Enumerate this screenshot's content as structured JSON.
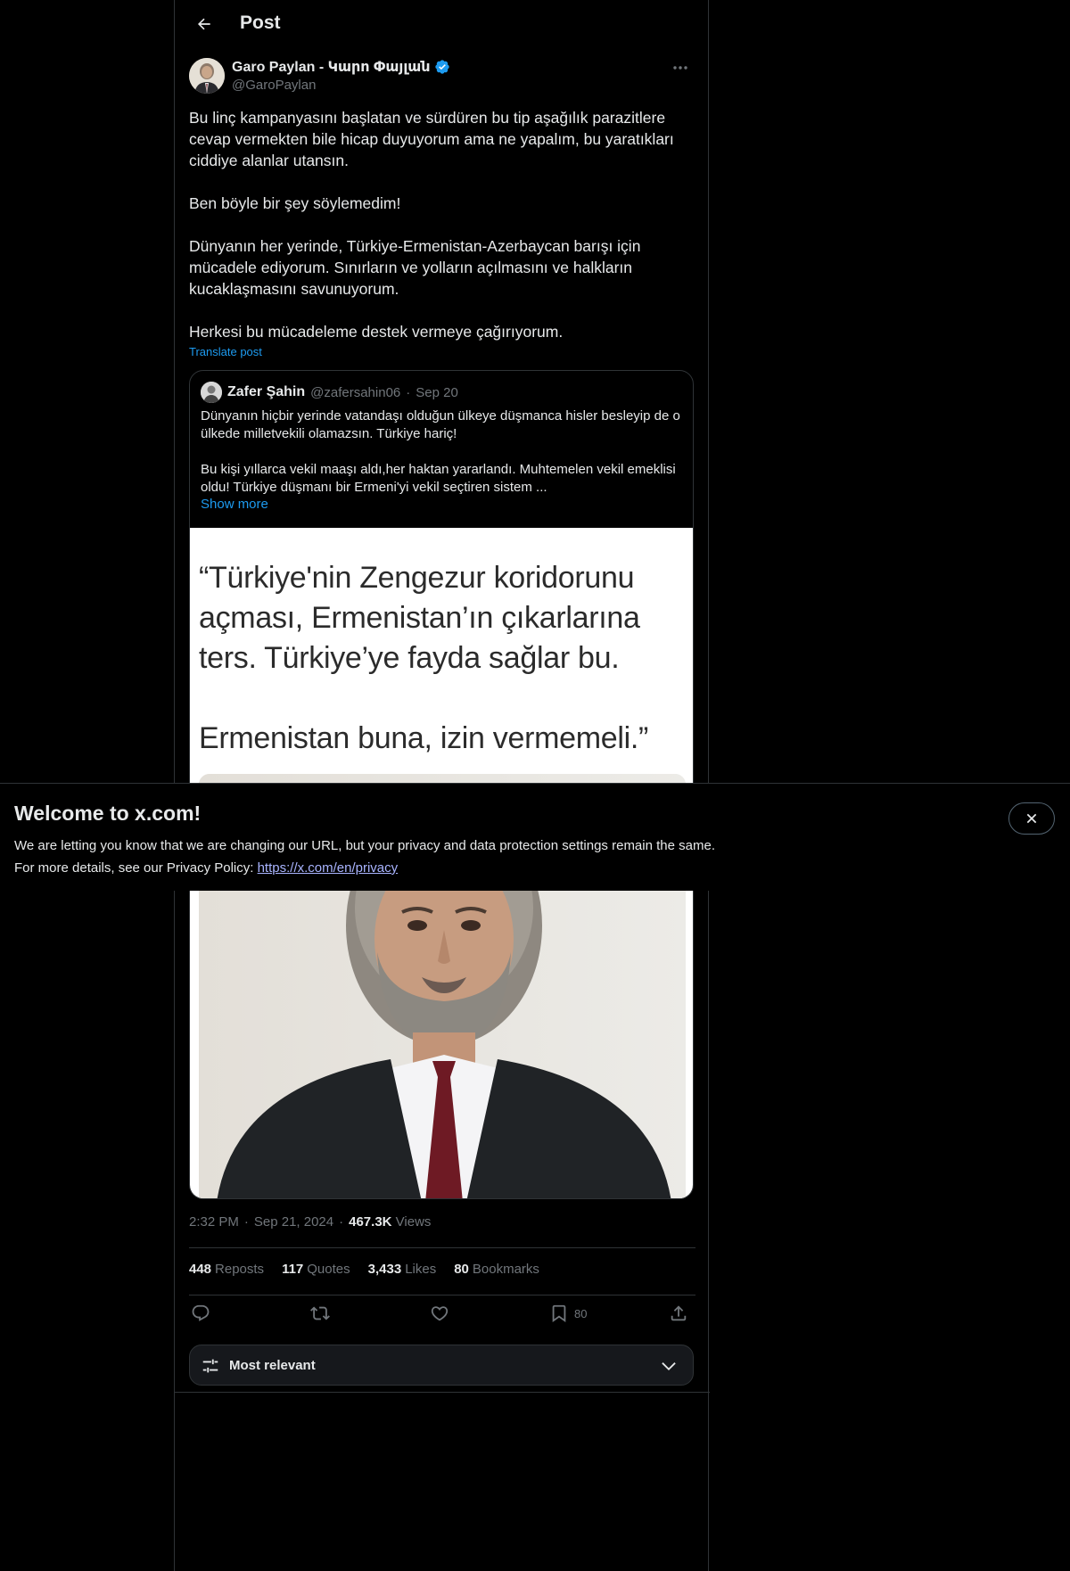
{
  "header": {
    "title": "Post"
  },
  "author": {
    "name": "Garo Paylan - Կարո Փայլան",
    "handle": "@GaroPaylan"
  },
  "post": {
    "paragraphs": [
      "Bu linç kampanyasını başlatan ve sürdüren bu tip aşağılık parazitlere cevap vermekten bile hicap duyuyorum ama ne yapalım, bu yaratıkları ciddiye alanlar utansın.",
      "Ben böyle bir şey söylemedim!",
      "Dünyanın her yerinde, Türkiye-Ermenistan-Azerbaycan barışı için mücadele ediyorum. Sınırların ve yolların açılmasını ve halkların kucaklaşmasını savunuyorum.",
      "Herkesi bu mücadeleme destek vermeye çağırıyorum."
    ],
    "translate_label": "Translate post"
  },
  "quote": {
    "name": "Zafer Şahin",
    "handle": "@zafersahin06",
    "separator": "·",
    "date": "Sep 20",
    "paragraphs": [
      "Dünyanın hiçbir yerinde vatandaşı olduğun ülkeye düşmanca hisler besleyip de o ülkede milletvekili olamazsın. Türkiye hariç!",
      "Bu kişi yıllarca vekil maaşı aldı,her haktan yararlandı. Muhtemelen vekil emeklisi oldu! Türkiye düşmanı bir Ermeni'yi vekil seçtiren sistem ..."
    ],
    "show_more": "Show more",
    "image_text": {
      "line1": "“Türkiye'nin Zengezur koridorunu",
      "line2": "açması, Ermenistan’ın çıkarlarına",
      "line3": "ters. Türkiye’ye fayda sağlar bu.",
      "line4": "Ermenistan buna, izin vermemeli.”"
    }
  },
  "meta": {
    "time": "2:32 PM",
    "sep1": "·",
    "date": "Sep 21, 2024",
    "sep2": "·",
    "views_count": "467.3K",
    "views_label": "Views"
  },
  "stats": {
    "reposts_count": "448",
    "reposts_label": "Reposts",
    "quotes_count": "117",
    "quotes_label": "Quotes",
    "likes_count": "3,433",
    "likes_label": "Likes",
    "bookmarks_count": "80",
    "bookmarks_label": "Bookmarks"
  },
  "actions": {
    "bookmark_count": "80",
    "icons": [
      "reply-icon",
      "repost-icon",
      "like-icon",
      "bookmark-icon",
      "share-icon"
    ]
  },
  "sort": {
    "label": "Most relevant"
  },
  "banner": {
    "title": "Welcome to x.com!",
    "line1": "We are letting you know that we are changing our URL, but your privacy and data protection settings remain the same.",
    "line2_prefix": "For more details, see our Privacy Policy: ",
    "link": "https://x.com/en/privacy"
  },
  "colors": {
    "background": "#000000",
    "text": "#e7e9ea",
    "muted": "#71767b",
    "accent": "#1d9bf0",
    "border": "#2f3336"
  }
}
